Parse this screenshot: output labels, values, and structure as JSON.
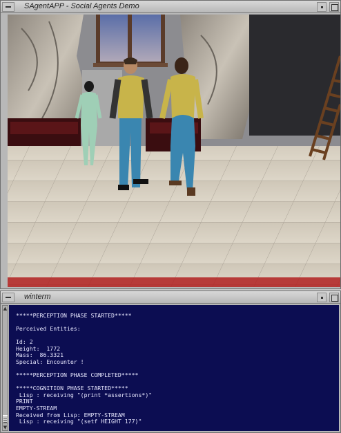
{
  "top_window": {
    "title": "SAgentAPP - Social Agents Demo"
  },
  "bottom_window": {
    "title": "winterm"
  },
  "terminal": {
    "lines": [
      "",
      "*****PERCEPTION PHASE STARTED*****",
      "",
      "Perceived Entities:",
      "",
      "Id: 2",
      "Height:  1772",
      "Mass:  86.3321",
      "Special: Encounter !",
      "",
      "*****PERCEPTION PHASE COMPLETED*****",
      "",
      "*****COGNITION PHASE STARTED*****",
      " Lisp : receiving \"(print *assertions*)\"",
      "PRINT",
      "EMPTY-STREAM",
      "Received from Lisp: EMPTY-STREAM",
      " Lisp : receiving \"(setf HEIGHT 177)\""
    ]
  },
  "colors": {
    "terminal_bg": "#0c0d52",
    "terminal_fg": "#e8e8ff",
    "window_chrome": "#b8b8b8"
  }
}
